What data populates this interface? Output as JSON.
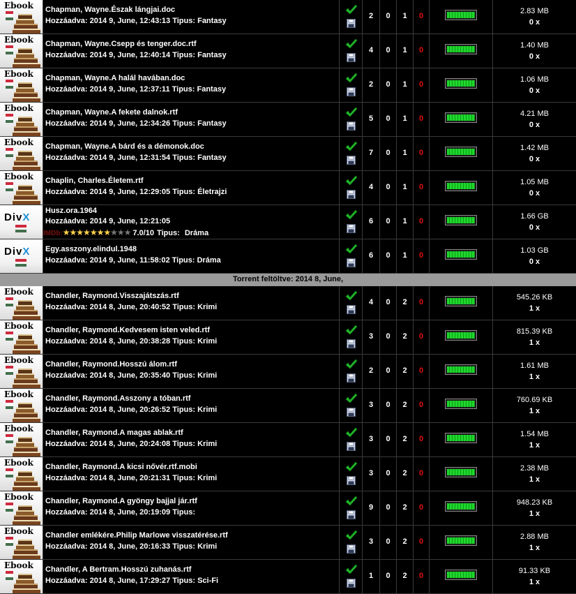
{
  "labels": {
    "added": "Hozzáadva:",
    "type": "Tipus:"
  },
  "colors": {
    "zero_column": "#e41010",
    "health_fill": "#1ed72c",
    "banner_bg": "#9a9a9a"
  },
  "banner": {
    "text": "Torrent feltöltve: 2014 8, June,"
  },
  "rows": [
    {
      "icon": "ebook",
      "icon_text": "Ebook",
      "title": "Chapman, Wayne.Észak lángjai.doc",
      "date": "2014 9, June, 12:43:13",
      "genre": "Fantasy",
      "seeders": "2",
      "leechers": "0",
      "completed": "1",
      "extra": "0",
      "health": 1,
      "size": "2.83 MB",
      "count": "0 x"
    },
    {
      "icon": "ebook",
      "icon_text": "Ebook",
      "title": "Chapman, Wayne.Csepp és tenger.doc.rtf",
      "date": "2014 9, June, 12:40:14",
      "genre": "Fantasy",
      "seeders": "4",
      "leechers": "0",
      "completed": "1",
      "extra": "0",
      "health": 1,
      "size": "1.40 MB",
      "count": "0 x"
    },
    {
      "icon": "ebook",
      "icon_text": "Ebook",
      "title": "Chapman, Wayne.A halál havában.doc",
      "date": "2014 9, June, 12:37:11",
      "genre": "Fantasy",
      "seeders": "2",
      "leechers": "0",
      "completed": "1",
      "extra": "0",
      "health": 1,
      "size": "1.06 MB",
      "count": "0 x"
    },
    {
      "icon": "ebook",
      "icon_text": "Ebook",
      "title": "Chapman, Wayne.A fekete dalnok.rtf",
      "date": "2014 9, June, 12:34:26",
      "genre": "Fantasy",
      "seeders": "5",
      "leechers": "0",
      "completed": "1",
      "extra": "0",
      "health": 1,
      "size": "4.21 MB",
      "count": "0 x"
    },
    {
      "icon": "ebook",
      "icon_text": "Ebook",
      "title": "Chapman, Wayne.A bárd és a démonok.doc",
      "date": "2014 9, June, 12:31:54",
      "genre": "Fantasy",
      "seeders": "7",
      "leechers": "0",
      "completed": "1",
      "extra": "0",
      "health": 1,
      "size": "1.42 MB",
      "count": "0 x"
    },
    {
      "icon": "ebook",
      "icon_text": "Ebook",
      "title": "Chaplin, Charles.Életem.rtf",
      "date": "2014 9, June, 12:29:05",
      "genre": "Életrajzi",
      "seeders": "4",
      "leechers": "0",
      "completed": "1",
      "extra": "0",
      "health": 1,
      "size": "1.05 MB",
      "count": "0 x"
    },
    {
      "icon": "divx",
      "icon_text": "DivX",
      "title": "Husz.ora.1964",
      "date": "2014 9, June, 12:21:05",
      "genre": "Dráma",
      "imdb": {
        "tag": "IMDb:",
        "rating": 7,
        "score": "7.0/10"
      },
      "seeders": "6",
      "leechers": "0",
      "completed": "1",
      "extra": "0",
      "health": 1,
      "size": "1.66 GB",
      "count": "0 x"
    },
    {
      "icon": "divx",
      "icon_text": "DivX",
      "title": "Egy.asszony.elindul.1948",
      "date": "2014 9, June, 11:58:02",
      "genre": "Dráma",
      "seeders": "6",
      "leechers": "0",
      "completed": "1",
      "extra": "0",
      "health": 1,
      "size": "1.03 GB",
      "count": "0 x"
    },
    {
      "banner": true
    },
    {
      "icon": "ebook",
      "icon_text": "Ebook",
      "title": "Chandler, Raymond.Visszajátszás.rtf",
      "date": "2014 8, June, 20:40:52",
      "genre": "Krimi",
      "seeders": "4",
      "leechers": "0",
      "completed": "2",
      "extra": "0",
      "health": 1,
      "size": "545.26 KB",
      "count": "1 x"
    },
    {
      "icon": "ebook",
      "icon_text": "Ebook",
      "title": "Chandler, Raymond.Kedvesem isten veled.rtf",
      "date": "2014 8, June, 20:38:28",
      "genre": "Krimi",
      "seeders": "3",
      "leechers": "0",
      "completed": "2",
      "extra": "0",
      "health": 1,
      "size": "815.39 KB",
      "count": "1 x"
    },
    {
      "icon": "ebook",
      "icon_text": "Ebook",
      "title": "Chandler, Raymond.Hosszú álom.rtf",
      "date": "2014 8, June, 20:35:40",
      "genre": "Krimi",
      "seeders": "2",
      "leechers": "0",
      "completed": "2",
      "extra": "0",
      "health": 1,
      "size": "1.61 MB",
      "count": "1 x"
    },
    {
      "icon": "ebook",
      "icon_text": "Ebook",
      "title": "Chandler, Raymond.Asszony a tóban.rtf",
      "date": "2014 8, June, 20:26:52",
      "genre": "Krimi",
      "seeders": "3",
      "leechers": "0",
      "completed": "2",
      "extra": "0",
      "health": 1,
      "size": "760.69 KB",
      "count": "1 x"
    },
    {
      "icon": "ebook",
      "icon_text": "Ebook",
      "title": "Chandler, Raymond.A magas ablak.rtf",
      "date": "2014 8, June, 20:24:08",
      "genre": "Krimi",
      "seeders": "3",
      "leechers": "0",
      "completed": "2",
      "extra": "0",
      "health": 1,
      "size": "1.54 MB",
      "count": "1 x"
    },
    {
      "icon": "ebook",
      "icon_text": "Ebook",
      "title": "Chandler, Raymond.A kicsi nővér.rtf.mobi",
      "date": "2014 8, June, 20:21:31",
      "genre": "Krimi",
      "seeders": "3",
      "leechers": "0",
      "completed": "2",
      "extra": "0",
      "health": 1,
      "size": "2.38 MB",
      "count": "1 x"
    },
    {
      "icon": "ebook",
      "icon_text": "Ebook",
      "title": "Chandler, Raymond.A gyöngy bajjal jár.rtf",
      "date": "2014 8, June, 20:19:09",
      "genre": "",
      "seeders": "9",
      "leechers": "0",
      "completed": "2",
      "extra": "0",
      "health": 1,
      "size": "948.23 KB",
      "count": "1 x"
    },
    {
      "icon": "ebook",
      "icon_text": "Ebook",
      "title": "Chandler emlékére.Philip Marlowe visszatérése.rtf",
      "date": "2014 8, June, 20:16:33",
      "genre": "Krimi",
      "seeders": "3",
      "leechers": "0",
      "completed": "2",
      "extra": "0",
      "health": 1,
      "size": "2.88 MB",
      "count": "1 x"
    },
    {
      "icon": "ebook",
      "icon_text": "Ebook",
      "title": "Chandler, A Bertram.Hosszú zuhanás.rtf",
      "date": "2014 8, June, 17:29:27",
      "genre": "Sci-Fi",
      "seeders": "1",
      "leechers": "0",
      "completed": "2",
      "extra": "0",
      "health": 1,
      "size": "91.33 KB",
      "count": "1 x"
    }
  ]
}
